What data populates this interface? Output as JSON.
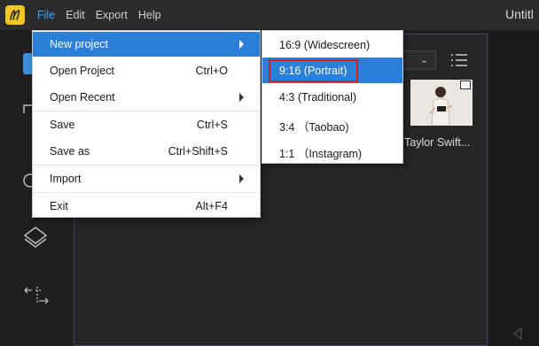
{
  "app": {
    "window_title": "Untitl",
    "menubar": [
      "File",
      "Edit",
      "Export",
      "Help"
    ]
  },
  "file_menu": {
    "items": [
      {
        "label": "New project",
        "shortcut": "",
        "submenu": true
      },
      {
        "label": "Open Project",
        "shortcut": "Ctrl+O",
        "submenu": false
      },
      {
        "label": "Open Recent",
        "shortcut": "",
        "submenu": true
      },
      {
        "label": "Save",
        "shortcut": "Ctrl+S",
        "submenu": false
      },
      {
        "label": "Save as",
        "shortcut": "Ctrl+Shift+S",
        "submenu": false
      },
      {
        "label": "Import",
        "shortcut": "",
        "submenu": true
      },
      {
        "label": "Exit",
        "shortcut": "Alt+F4",
        "submenu": false
      }
    ]
  },
  "new_project_submenu": {
    "items": [
      "16:9 (Widescreen)",
      "9:16 (Portrait)",
      "4:3 (Traditional)",
      "3:4 （Taobao)",
      "1:1 （Instagram)"
    ],
    "selected": "9:16 (Portrait)"
  },
  "media": {
    "thumbnail_label": "Taylor Swift..."
  },
  "colors": {
    "accent": "#2b7fd8",
    "menu_active_text": "#3da6ff",
    "highlight_box": "#d62020",
    "logo": "#f2c42b"
  }
}
